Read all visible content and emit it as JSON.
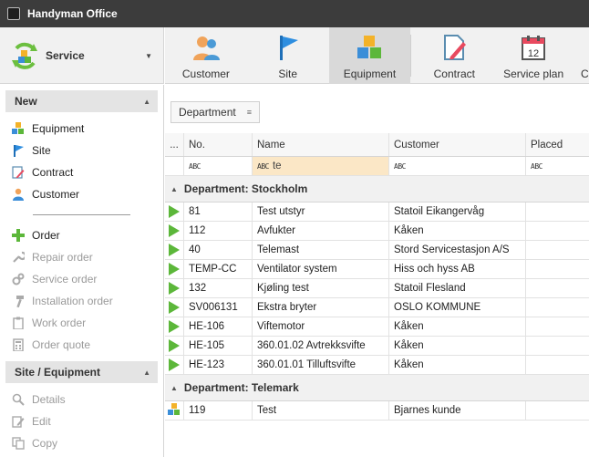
{
  "window": {
    "title": "Handyman Office"
  },
  "module": {
    "name": "Service"
  },
  "ribbon": {
    "tabs": [
      {
        "label": "Customer",
        "icon": "customer-icon"
      },
      {
        "label": "Site",
        "icon": "flag-icon"
      },
      {
        "label": "Equipment",
        "icon": "equipment-cubes-icon",
        "active": true
      },
      {
        "label": "Contract",
        "icon": "contract-icon"
      },
      {
        "label": "Service plan",
        "icon": "calendar-icon"
      }
    ],
    "calendar_day": "12"
  },
  "sidebar": {
    "new_group": {
      "title": "New",
      "items": [
        {
          "label": "Equipment",
          "icon": "equipment-cubes-icon"
        },
        {
          "label": "Site",
          "icon": "flag-icon"
        },
        {
          "label": "Contract",
          "icon": "contract-icon"
        },
        {
          "label": "Customer",
          "icon": "customer-icon"
        }
      ],
      "order_items": [
        {
          "label": "Order",
          "icon": "plus-icon",
          "enabled": true
        },
        {
          "label": "Repair order",
          "icon": "wrench-icon",
          "enabled": false
        },
        {
          "label": "Service order",
          "icon": "gears-icon",
          "enabled": false
        },
        {
          "label": "Installation order",
          "icon": "hammer-icon",
          "enabled": false
        },
        {
          "label": "Work order",
          "icon": "clipboard-icon",
          "enabled": false
        },
        {
          "label": "Order quote",
          "icon": "calculator-icon",
          "enabled": false
        }
      ]
    },
    "site_group": {
      "title": "Site / Equipment",
      "items": [
        {
          "label": "Details",
          "icon": "magnifier-icon"
        },
        {
          "label": "Edit",
          "icon": "edit-icon"
        },
        {
          "label": "Copy",
          "icon": "copy-icon"
        }
      ]
    }
  },
  "grouping": {
    "chip_label": "Department"
  },
  "grid": {
    "columns": [
      "...",
      "No.",
      "Name",
      "Customer",
      "Placed"
    ],
    "filter": {
      "abc": "ABC",
      "name_value": "te"
    },
    "groups": [
      {
        "label": "Department: Stockholm",
        "rows": [
          {
            "no": "81",
            "name": "Test utstyr",
            "customer": "Statoil Eikangervåg",
            "placed": ""
          },
          {
            "no": "112",
            "name": "Avfukter",
            "customer": "Kåken",
            "placed": ""
          },
          {
            "no": "40",
            "name": "Telemast",
            "customer": "Stord Servicestasjon A/S",
            "placed": ""
          },
          {
            "no": "TEMP-CC",
            "name": "Ventilator system",
            "customer": "Hiss och hyss AB",
            "placed": ""
          },
          {
            "no": "132",
            "name": "Kjøling test",
            "customer": "Statoil Flesland",
            "placed": ""
          },
          {
            "no": "SV006131",
            "name": "Ekstra bryter",
            "customer": "OSLO KOMMUNE",
            "placed": ""
          },
          {
            "no": "HE-106",
            "name": "Viftemotor",
            "customer": "Kåken",
            "placed": ""
          },
          {
            "no": "HE-105",
            "name": "360.01.02 Avtrekksvifte",
            "customer": "Kåken",
            "placed": ""
          },
          {
            "no": "HE-123",
            "name": "360.01.01 Tilluftsvifte",
            "customer": "Kåken",
            "placed": ""
          }
        ]
      },
      {
        "label": "Department: Telemark",
        "rows": [
          {
            "no": "119",
            "name": "Test",
            "customer": "Bjarnes kunde",
            "placed": "",
            "icon": "equipment-cubes-icon"
          }
        ]
      }
    ]
  },
  "colors": {
    "accent_green": "#5cb73a",
    "titlebar": "#3c3c3c",
    "active_tab": "#d9d9d9",
    "filter_highlight": "#fbe7c6"
  }
}
